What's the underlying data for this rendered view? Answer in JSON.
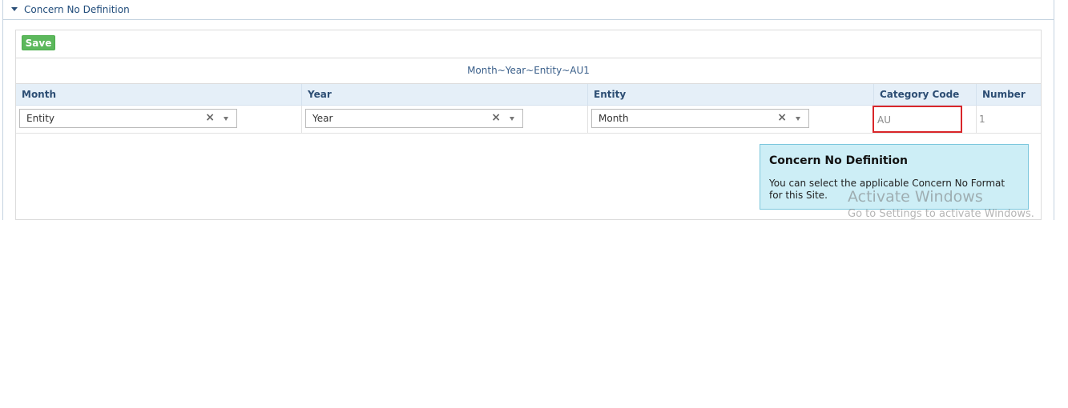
{
  "section": {
    "title": "Concern No Definition"
  },
  "toolbar": {
    "save_label": "Save"
  },
  "format_preview": "Month~Year~Entity~AU1",
  "grid": {
    "headers": [
      "Month",
      "Year",
      "Entity",
      "Category Code",
      "Number"
    ],
    "row": {
      "month_select": "Entity",
      "year_select": "Year",
      "entity_select": "Month",
      "category_code": "AU",
      "number": "1"
    }
  },
  "tooltip": {
    "title": "Concern No Definition",
    "body": "You can select the applicable Concern No Format for this Site."
  },
  "watermark": {
    "line1": "Activate Windows",
    "line2": "Go to Settings to activate Windows."
  },
  "colors": {
    "accent": "#1f4b7a",
    "save": "#5cb85c",
    "highlight": "#d9262a",
    "tooltip_bg": "#cdeef6"
  }
}
